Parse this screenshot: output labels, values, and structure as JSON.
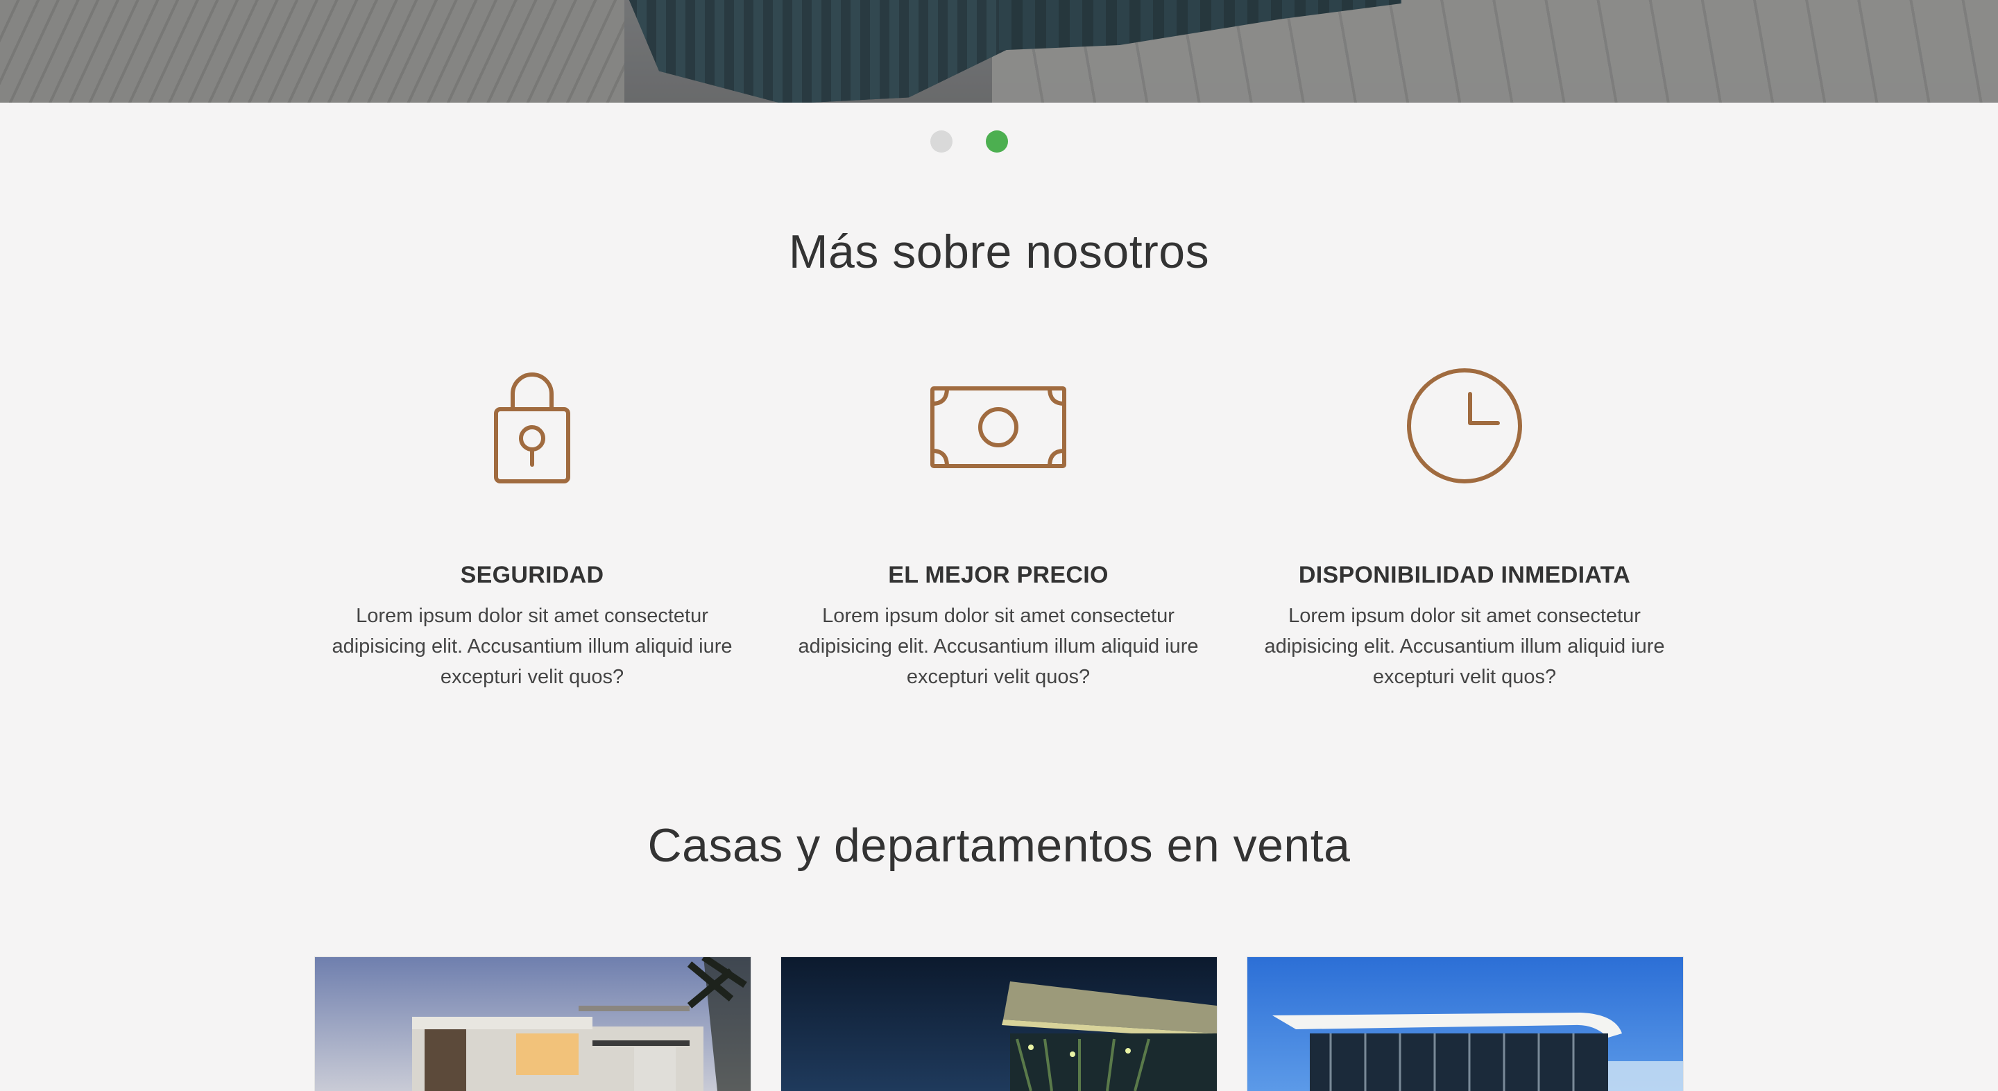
{
  "slider": {
    "dots": [
      {
        "label": "slide-1",
        "active": false
      },
      {
        "label": "slide-2",
        "active": true
      }
    ],
    "active_color": "#4caf50",
    "inactive_color": "#d9d9d9"
  },
  "about": {
    "title": "Más sobre nosotros",
    "icon_color": "#a06b3f",
    "features": [
      {
        "icon": "lock-icon",
        "title": "SEGURIDAD",
        "text": "Lorem ipsum dolor sit amet consectetur adipisicing elit. Accusantium illum aliquid iure excepturi velit quos?"
      },
      {
        "icon": "banknote-icon",
        "title": "EL MEJOR PRECIO",
        "text": "Lorem ipsum dolor sit amet consectetur adipisicing elit. Accusantium illum aliquid iure excepturi velit quos?"
      },
      {
        "icon": "clock-icon",
        "title": "DISPONIBILIDAD INMEDIATA",
        "text": "Lorem ipsum dolor sit amet consectetur adipisicing elit. Accusantium illum aliquid iure excepturi velit quos?"
      }
    ]
  },
  "listings": {
    "title": "Casas y departamentos en venta"
  }
}
